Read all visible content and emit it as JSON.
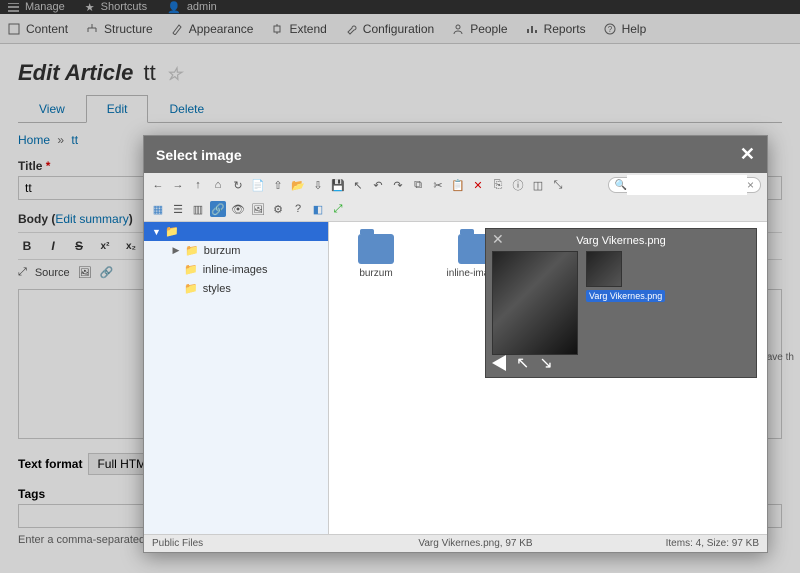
{
  "topbar": {
    "manage": "Manage",
    "shortcuts": "Shortcuts",
    "admin": "admin"
  },
  "admin_menu": {
    "content": "Content",
    "structure": "Structure",
    "appearance": "Appearance",
    "extend": "Extend",
    "configuration": "Configuration",
    "people": "People",
    "reports": "Reports",
    "help": "Help"
  },
  "page": {
    "title_prefix": "Edit Article",
    "title_name": "tt",
    "tabs": {
      "view": "View",
      "edit": "Edit",
      "delete": "Delete"
    },
    "breadcrumb": {
      "home": "Home",
      "current": "tt"
    },
    "title_label": "Title",
    "title_value": "tt",
    "body_label": "Body",
    "edit_summary": "Edit summary",
    "source_label": "Source",
    "text_format_label": "Text format",
    "text_format_value": "Full HTML",
    "tags_label": "Tags",
    "tags_help": "Enter a comma-separated list. For example: Amsterdam, Mexico City, \"Cleveland, Ohio\"",
    "save_hint": "save th"
  },
  "modal": {
    "title": "Select image",
    "search_placeholder": "",
    "tree": {
      "root": "",
      "items": [
        "burzum",
        "inline-images",
        "styles"
      ]
    },
    "folders": [
      {
        "name": "burzum"
      },
      {
        "name": "inline-images"
      }
    ],
    "preview": {
      "filename": "Varg Vikernes.png",
      "thumb_label": "Varg Vikernes.png"
    },
    "status": {
      "path": "Public Files",
      "file": "Varg Vikernes.png, 97 KB",
      "summary": "Items: 4, Size: 97 KB"
    }
  }
}
